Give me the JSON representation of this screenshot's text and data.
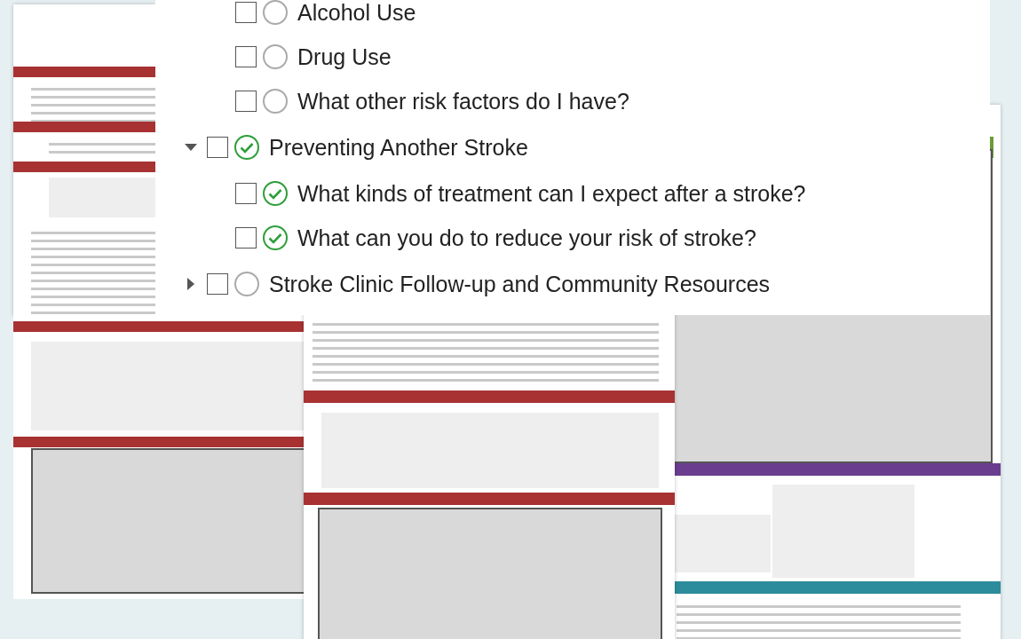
{
  "tree": {
    "continued_children": [
      {
        "label": "Alcohol Use",
        "checked": false,
        "complete": false
      },
      {
        "label": "Drug Use",
        "checked": false,
        "complete": false
      },
      {
        "label": "What other risk factors do I have?",
        "checked": false,
        "complete": false
      }
    ],
    "items": [
      {
        "label": "Preventing Another Stroke",
        "expanded": true,
        "checked": false,
        "complete": true,
        "children": [
          {
            "label": "What kinds of treatment can I expect after a stroke?",
            "checked": false,
            "complete": true
          },
          {
            "label": "What can you do to reduce your risk of stroke?",
            "checked": false,
            "complete": true
          }
        ]
      },
      {
        "label": "Stroke Clinic Follow-up and Community Resources",
        "expanded": false,
        "checked": false,
        "complete": false
      }
    ]
  }
}
